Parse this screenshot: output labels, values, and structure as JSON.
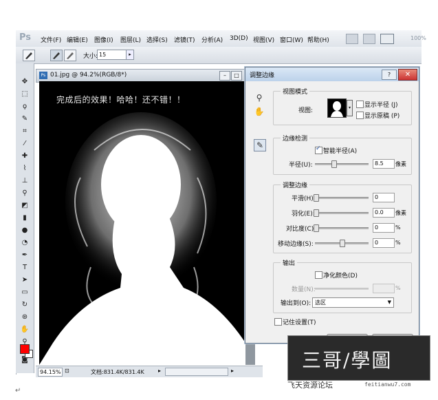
{
  "app": {
    "logo": "Ps",
    "menu": [
      "文件(F)",
      "编辑(E)",
      "图像(I)",
      "图层(L)",
      "选择(S)",
      "滤镜(T)",
      "分析(A)",
      "3D(D)",
      "视图(V)",
      "窗口(W)",
      "帮助(H)"
    ],
    "zoom_display": "100%"
  },
  "options_bar": {
    "size_label": "大小:",
    "size_value": "15"
  },
  "document": {
    "title": "01.jpg @ 94.2%(RGB/8*)",
    "caption": "完成后的效果！哈哈！还不错！！",
    "zoom": "94.15%",
    "status": "文档:831.4K/831.4K"
  },
  "dialog": {
    "title": "调整边缘",
    "view_mode": {
      "group_title": "视图模式",
      "view_label": "视图:",
      "show_radius_label": "显示半径 (J)",
      "show_original_label": "显示原稿 (P)",
      "show_radius_checked": false,
      "show_original_checked": false
    },
    "edge_detection": {
      "group_title": "边缘检测",
      "smart_radius_label": "智能半径(A)",
      "smart_radius_checked": true,
      "radius_label": "半径(U):",
      "radius_value": "8.5",
      "radius_unit": "像素",
      "radius_position": 0.31
    },
    "adjust_edge": {
      "group_title": "调整边缘",
      "smooth_label": "平滑(H):",
      "smooth_value": "0",
      "feather_label": "羽化(E):",
      "feather_value": "0.0",
      "feather_unit": "像素",
      "contrast_label": "对比度(C):",
      "contrast_value": "0",
      "contrast_unit": "%",
      "shift_label": "移动边缘(S):",
      "shift_value": "0",
      "shift_unit": "%",
      "shift_position": 0.5
    },
    "output": {
      "group_title": "输出",
      "decontaminate_label": "净化颜色(D)",
      "decontaminate_checked": false,
      "amount_label": "数量(N):",
      "amount_unit": "%",
      "output_to_label": "输出到(O):",
      "output_to_value": "选区"
    },
    "remember_label": "记住设置(T)",
    "remember_checked": false
  },
  "watermark": {
    "title": "三哥/學圖",
    "site": "飞天资源论坛",
    "url": "feitianwu7.com"
  },
  "colors": {
    "foreground": "#ff0000",
    "background": "#ffffff",
    "dialog_bg": "#f0f0f0"
  }
}
